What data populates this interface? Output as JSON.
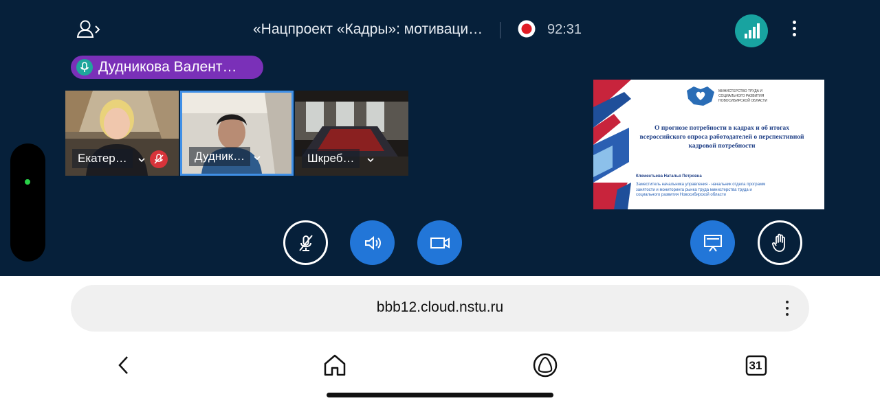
{
  "meeting": {
    "title": "«Нацпроект «Кадры»: мотиваци…",
    "timer": "92:31",
    "active_speaker": "Дудникова Валент…"
  },
  "participants": [
    {
      "name": "Екатер…",
      "muted": true
    },
    {
      "name": "Дудник…",
      "muted": false,
      "highlighted": true
    },
    {
      "name": "Шкреб…",
      "muted": false
    }
  ],
  "presentation": {
    "ministry": "Министерство труда и социального развития Новосибирской области",
    "title": "О прогнозе потребности в кадрах и об итогах всероссийского опроса работодателей о перспективной кадровой потребности",
    "author": "Клементьева Наталья Петровна",
    "position": "Заместитель начальника управления - начальник отдела программ занятости и мониторинга рынка труда министерства труда и социального развития Новосибирской области"
  },
  "controls": [
    "mic-muted-icon",
    "speaker-icon",
    "camera-icon",
    "presentation-icon",
    "raise-hand-icon"
  ],
  "browser": {
    "url": "bbb12.cloud.nstu.ru",
    "tab_count": "31"
  },
  "colors": {
    "background": "#06203a",
    "accent_blue": "#2276d8",
    "speaker_pill": "#7a30b8",
    "signal_teal": "#18a3a0",
    "record_red": "#e01b24"
  }
}
